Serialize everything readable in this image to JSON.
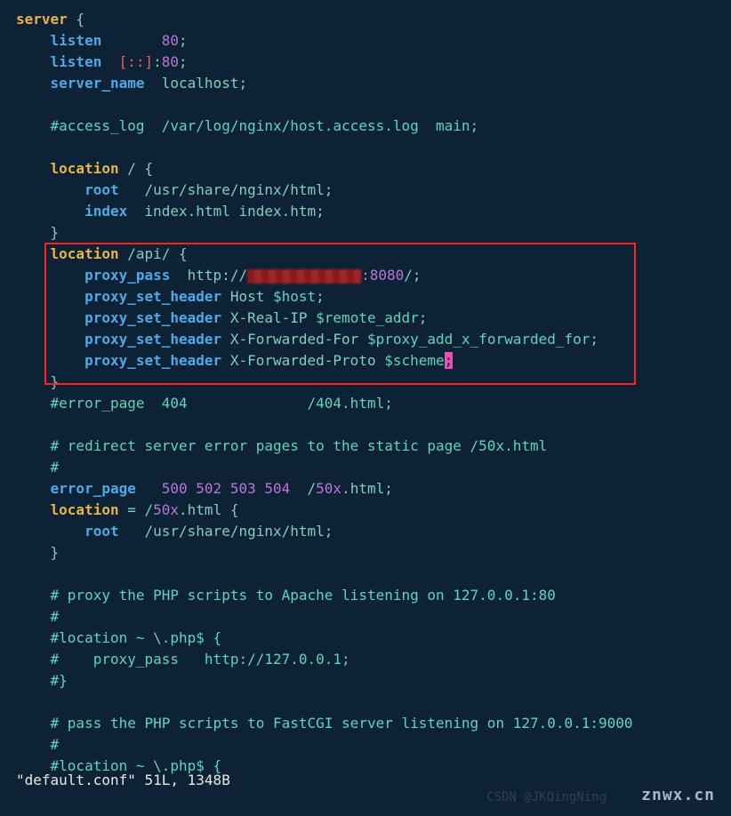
{
  "code": {
    "server_kw": "server",
    "brace_open": " {",
    "listen1": {
      "kw": "listen",
      "port": "80",
      "semi": ";"
    },
    "listen2": {
      "kw": "listen",
      "bracket": "[::]",
      "colon": ":",
      "port": "80",
      "semi": ";"
    },
    "server_name": {
      "kw": "server_name",
      "val": "  localhost;"
    },
    "comment_access": "#access_log  /var/log/nginx/host.access.log  main;",
    "loc1": {
      "kw": "location",
      "path": " / {"
    },
    "loc1_root": {
      "kw": "root",
      "val": "   /usr/share/nginx/html;"
    },
    "loc1_index": {
      "kw": "index",
      "val1": "  index",
      "ext1": ".html ",
      "val2": "index",
      "ext2": ".htm;"
    },
    "loc1_close": "}",
    "loc2": {
      "kw": "location",
      "path": " /api/ {"
    },
    "loc2_proxy": {
      "kw": "proxy_pass",
      "prefix": "  http://",
      "port": ":8080",
      "suffix": "/;"
    },
    "loc2_h1": {
      "kw": "proxy_set_header",
      "val": " Host ",
      "var": "$host",
      "semi": ";"
    },
    "loc2_h2": {
      "kw": "proxy_set_header",
      "val": " X-Real-IP ",
      "var": "$remote_addr",
      "semi": ";"
    },
    "loc2_h3": {
      "kw": "proxy_set_header",
      "val": " X-Forwarded-For ",
      "var": "$proxy_add_x_forwarded_for",
      "semi": ";"
    },
    "loc2_h4": {
      "kw": "proxy_set_header",
      "val": " X-Forwarded-Proto ",
      "var": "$scheme",
      "semi": ";"
    },
    "loc2_close": "}",
    "comment_err404": "#error_page  404              /404.html;",
    "comment_redirect1": "# redirect server error pages to the static page /50x.html",
    "comment_hash": "#",
    "error_page": {
      "kw": "error_page",
      "codes": "   500 502 503 504",
      "path1": "  /",
      "file": "50x",
      "ext": ".html;"
    },
    "loc3": {
      "kw": "location",
      "eq": " = /",
      "file": "50x",
      "ext": ".html {"
    },
    "loc3_root": {
      "kw": "root",
      "val": "   /usr/share/nginx/html;"
    },
    "loc3_close": "}",
    "comment_php1": "# proxy the PHP scripts to Apache listening on 127.0.0.1:80",
    "comment_php2": "#location ~ \\.php$ {",
    "comment_php3": "#    proxy_pass   http://127.0.0.1;",
    "comment_php4": "#}",
    "comment_fcgi1": "# pass the PHP scripts to FastCGI server listening on 127.0.0.1:9000",
    "comment_fcgi2": "#location ~ \\.php$ {"
  },
  "status": "\"default.conf\" 51L, 1348B",
  "watermark1": "CSDN @JKQingNing",
  "watermark2": "znwx.cn"
}
